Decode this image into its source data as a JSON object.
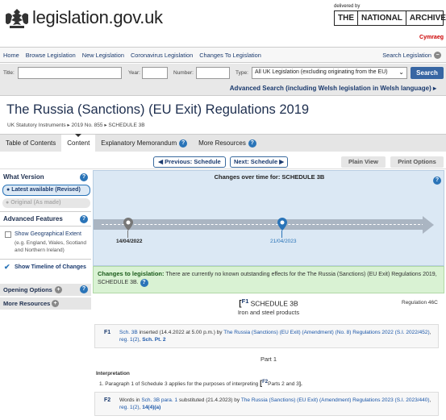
{
  "header": {
    "site_name": "legislation.gov.uk",
    "delivered_by": "delivered by",
    "archives": [
      "THE",
      "NATIONAL",
      "ARCHIVES"
    ],
    "cymraeg": "Cymraeg"
  },
  "topnav": {
    "items": [
      "Home",
      "Browse Legislation",
      "New Legislation",
      "Coronavirus Legislation",
      "Changes To Legislation"
    ],
    "search_toggle": "Search Legislation"
  },
  "search": {
    "title_label": "Title:",
    "title_value": "",
    "year_label": "Year:",
    "year_value": "",
    "number_label": "Number:",
    "number_value": "",
    "type_label": "Type:",
    "type_value": "All UK Legislation (excluding originating from the EU)",
    "button": "Search",
    "advanced": "Advanced Search (including Welsh legislation in Welsh language) ▸"
  },
  "page": {
    "title": "The Russia (Sanctions) (EU Exit) Regulations 2019",
    "breadcrumb": "UK Statutory Instruments ▸ 2019 No. 855 ▸ SCHEDULE 3B"
  },
  "tabs": [
    {
      "label": "Table of Contents",
      "help": false
    },
    {
      "label": "Content",
      "help": false
    },
    {
      "label": "Explanatory Memorandum",
      "help": true
    },
    {
      "label": "More Resources",
      "help": true
    }
  ],
  "subnav": {
    "previous": "◀ Previous: Schedule",
    "next": "Next: Schedule ▶",
    "plain_view": "Plain View",
    "print_options": "Print Options"
  },
  "sidebar": {
    "what_version": "What Version",
    "latest": "Latest available (Revised)",
    "original": "Original (As made)",
    "advanced_features": "Advanced Features",
    "geo_extent": "Show Geographical Extent",
    "geo_extent_note": "(e.g. England, Wales, Scotland and Northern Ireland)",
    "timeline": "Show Timeline of Changes",
    "opening_options": "Opening Options",
    "more_resources": "More Resources"
  },
  "timeline": {
    "heading": "Changes over time for: SCHEDULE 3B",
    "dates": [
      "14/04/2022",
      "21/04/2023"
    ]
  },
  "changes": {
    "label": "Changes to legislation:",
    "text": "There are currently no known outstanding effects for the The Russia (Sanctions) (EU Exit) Regulations 2019, SCHEDULE 3B."
  },
  "schedule": {
    "f_tag": "F1",
    "heading": "SCHEDULE 3B",
    "subheading": "Iron and steel products",
    "regulation_ref": "Regulation 46C",
    "part": "Part 1",
    "interpretation": "Interpretation",
    "para1_a": "1. Paragraph 1 of Schedule 3 applies for the purposes of interpreting",
    "para1_f2": "F2",
    "para1_b": "Parts 2 and 3",
    "para1_c": "]."
  },
  "footnotes": [
    {
      "tag": "F1",
      "link1": "Sch. 3B",
      "text1": " inserted (14.4.2022 at 5.00 p.m.) by ",
      "link2": "The Russia (Sanctions) (EU Exit) (Amendment) (No. 8) Regulations 2022 (S.I. 2022/452)",
      "text2": ", ",
      "link3": "reg. 1(2)",
      "text3": ", ",
      "link4": "Sch. Pt. 2"
    },
    {
      "tag": "F2",
      "text0": "Words in ",
      "link1": "Sch. 3B para. 1",
      "text1": " substituted (21.4.2023) by ",
      "link2": "The Russia (Sanctions) (EU Exit) (Amendment) Regulations 2023 (S.I. 2023/440)",
      "text2": ", ",
      "link3": "reg. 1(2)",
      "text3": ", ",
      "link4": "14(4)(a)"
    }
  ]
}
